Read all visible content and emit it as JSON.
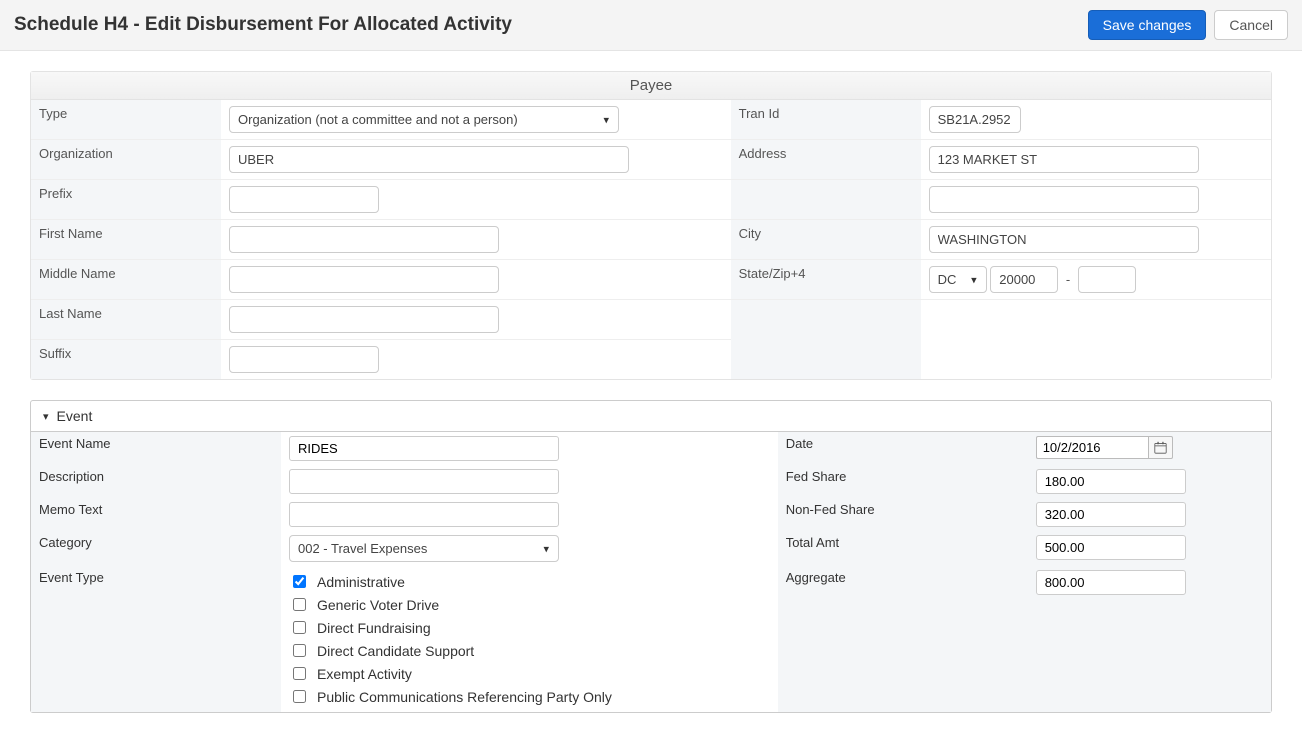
{
  "header": {
    "title": "Schedule H4 - Edit Disbursement For Allocated Activity",
    "save_label": "Save changes",
    "cancel_label": "Cancel"
  },
  "payee_panel": {
    "title": "Payee",
    "labels": {
      "type": "Type",
      "organization": "Organization",
      "prefix": "Prefix",
      "first_name": "First Name",
      "middle_name": "Middle Name",
      "last_name": "Last Name",
      "suffix": "Suffix",
      "tran_id": "Tran Id",
      "address": "Address",
      "city": "City",
      "state_zip": "State/Zip+4"
    },
    "values": {
      "type": "Organization (not a committee and not a person)",
      "organization": "UBER",
      "prefix": "",
      "first_name": "",
      "middle_name": "",
      "last_name": "",
      "suffix": "",
      "tran_id": "SB21A.2952",
      "address1": "123 MARKET ST",
      "address2": "",
      "city": "WASHINGTON",
      "state": "DC",
      "zip": "20000",
      "zip4": ""
    }
  },
  "event_panel": {
    "title": "Event",
    "labels": {
      "event_name": "Event Name",
      "description": "Description",
      "memo_text": "Memo Text",
      "category": "Category",
      "event_type": "Event Type",
      "date": "Date",
      "fed_share": "Fed Share",
      "non_fed_share": "Non-Fed Share",
      "total_amt": "Total Amt",
      "aggregate": "Aggregate"
    },
    "values": {
      "event_name": "RIDES",
      "description": "",
      "memo_text": "",
      "category": "002 - Travel Expenses",
      "date": "10/2/2016",
      "fed_share": "180.00",
      "non_fed_share": "320.00",
      "total_amt": "500.00",
      "aggregate": "800.00"
    },
    "event_types": [
      {
        "label": "Administrative",
        "checked": true
      },
      {
        "label": "Generic Voter Drive",
        "checked": false
      },
      {
        "label": "Direct Fundraising",
        "checked": false
      },
      {
        "label": "Direct Candidate Support",
        "checked": false
      },
      {
        "label": "Exempt Activity",
        "checked": false
      },
      {
        "label": "Public Communications Referencing Party Only",
        "checked": false
      }
    ]
  }
}
